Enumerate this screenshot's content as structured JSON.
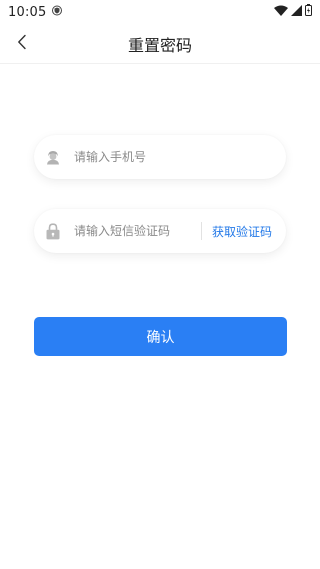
{
  "status_bar": {
    "time": "10:05",
    "icons": [
      "shield-icon",
      "wifi-icon",
      "signal-icon",
      "battery-icon"
    ]
  },
  "nav": {
    "title": "重置密码",
    "back_icon": "chevron-left-icon"
  },
  "form": {
    "phone": {
      "icon": "user-icon",
      "placeholder": "请输入手机号",
      "value": ""
    },
    "code": {
      "icon": "lock-icon",
      "placeholder": "请输入短信验证码",
      "value": "",
      "get_code_label": "获取验证码"
    },
    "confirm_label": "确认"
  },
  "colors": {
    "accent": "#2a7ff4",
    "link": "#2379e8",
    "icon_gray": "#b5b5b5"
  }
}
